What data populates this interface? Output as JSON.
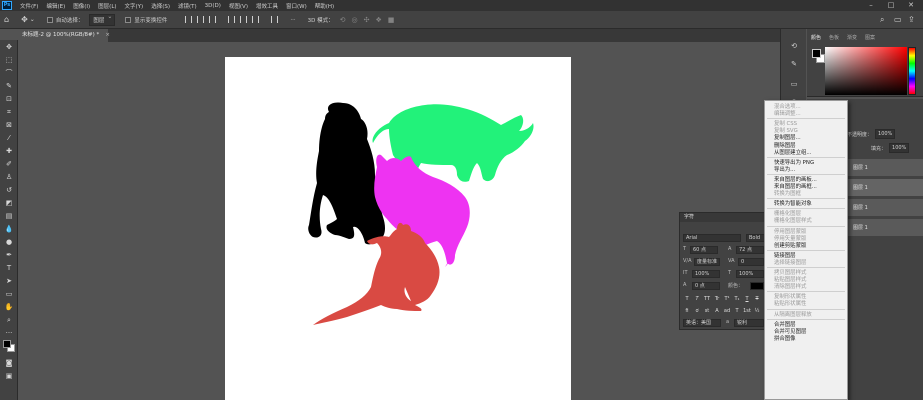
{
  "app": {
    "logo": "Ps",
    "menu": [
      "文件(F)",
      "编辑(E)",
      "图像(I)",
      "图层(L)",
      "文字(Y)",
      "选择(S)",
      "滤镜(T)",
      "3D(D)",
      "视图(V)",
      "增效工具",
      "窗口(W)",
      "帮助(H)"
    ]
  },
  "options_bar": {
    "auto_select_label": "自动选择：",
    "auto_select_value": "图层",
    "show_transform_label": "显示变换控件",
    "mode_3d_label": "3D 模式："
  },
  "document": {
    "tab_title": "未标题-2 @ 100%(RGB/8#) *"
  },
  "panels": {
    "color_tabs": [
      "颜色",
      "色板",
      "渐变",
      "图案"
    ],
    "layers": {
      "opacity_label": "不透明度：",
      "opacity_value": "100%",
      "fill_label": "填充：",
      "fill_value": "100%",
      "rows": [
        "图层 1",
        "图层 1",
        "图层 1",
        "图层 1"
      ]
    }
  },
  "character_panel": {
    "title": "字符",
    "font_family": "Arial",
    "font_style": "Bold",
    "font_size": "60 点",
    "leading": "72 点",
    "kerning": "度量标准",
    "tracking": "0",
    "vertical_scale": "100%",
    "horizontal_scale": "100%",
    "baseline_shift": "0 点",
    "color_label": "颜色：",
    "language": "英语：美国",
    "antialias": "锐利",
    "style_buttons": [
      "T",
      "T",
      "TT",
      "Tr",
      "T¹",
      "T₁",
      "T",
      "T"
    ],
    "opentype_buttons": [
      "fi",
      "ơ",
      "st",
      "A",
      "ad",
      "T",
      "1st",
      "½"
    ]
  },
  "context_menu": {
    "items": [
      {
        "label": "混合选项...",
        "enabled": false
      },
      {
        "label": "编辑调整...",
        "enabled": false
      },
      {
        "sep": true
      },
      {
        "label": "复制 CSS",
        "enabled": false
      },
      {
        "label": "复制 SVG",
        "enabled": false
      },
      {
        "label": "复制图层...",
        "enabled": true
      },
      {
        "label": "删除图层",
        "enabled": true
      },
      {
        "label": "从图层建立组...",
        "enabled": true
      },
      {
        "sep": true
      },
      {
        "label": "快速导出为 PNG",
        "enabled": true
      },
      {
        "label": "导出为...",
        "enabled": true
      },
      {
        "sep": true
      },
      {
        "label": "来自图层的画板...",
        "enabled": true
      },
      {
        "label": "来自图层的画框...",
        "enabled": true
      },
      {
        "label": "转换为图框",
        "enabled": false
      },
      {
        "sep": true
      },
      {
        "label": "转换为智能对象",
        "enabled": true
      },
      {
        "sep": true
      },
      {
        "label": "栅格化图层",
        "enabled": false
      },
      {
        "label": "栅格化图层样式",
        "enabled": false
      },
      {
        "sep": true
      },
      {
        "label": "停用图层蒙版",
        "enabled": false
      },
      {
        "label": "停用矢量蒙版",
        "enabled": false
      },
      {
        "label": "创建剪贴蒙版",
        "enabled": true
      },
      {
        "sep": true
      },
      {
        "label": "链接图层",
        "enabled": true
      },
      {
        "label": "选择链接图层",
        "enabled": false
      },
      {
        "sep": true
      },
      {
        "label": "拷贝图层样式",
        "enabled": false
      },
      {
        "label": "粘贴图层样式",
        "enabled": false
      },
      {
        "label": "清除图层样式",
        "enabled": false
      },
      {
        "sep": true
      },
      {
        "label": "复制形状属性",
        "enabled": false
      },
      {
        "label": "粘贴形状属性",
        "enabled": false
      },
      {
        "sep": true
      },
      {
        "label": "从隔离图层释放",
        "enabled": false
      },
      {
        "sep": true
      },
      {
        "label": "合并图层",
        "enabled": true
      },
      {
        "label": "合并可见图层",
        "enabled": true
      },
      {
        "label": "拼合图像",
        "enabled": true
      }
    ]
  },
  "colors": {
    "gorilla": "#000000",
    "rhino": "#22f27a",
    "cat": "#ee33f2",
    "kangaroo": "#d94a43"
  }
}
